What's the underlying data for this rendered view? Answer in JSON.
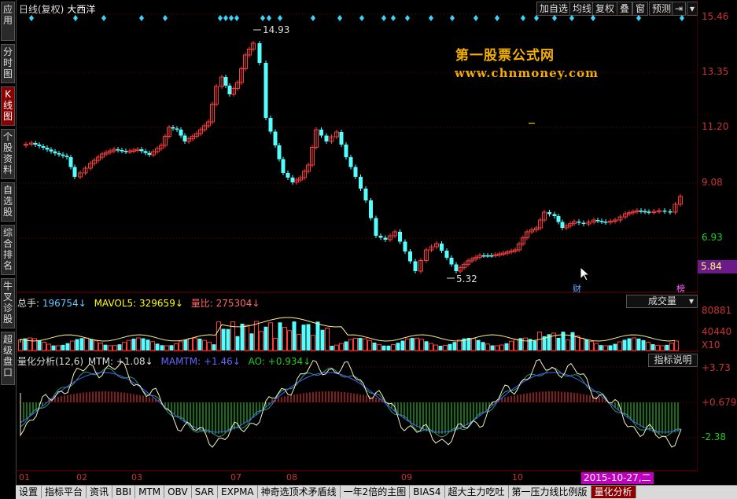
{
  "sidebar": {
    "tabs": [
      {
        "label": "应用",
        "active": false
      },
      {
        "label": "分时图",
        "active": false
      },
      {
        "label": "K线图",
        "active": true
      },
      {
        "label": "个股资料",
        "active": false
      },
      {
        "label": "自选股",
        "active": false
      },
      {
        "label": "综合排名",
        "active": false
      },
      {
        "label": "牛叉诊股",
        "active": false
      },
      {
        "label": "超级盘口",
        "active": false
      }
    ]
  },
  "header": {
    "period": "日线(复权)",
    "stock_name": "大西洋",
    "buttons": [
      "加自选",
      "均线",
      "复权",
      "叠",
      "窗",
      "预测"
    ]
  },
  "watermark": {
    "line1": "第一股票公式网",
    "line2": "www.chnmoney.com"
  },
  "main_chart": {
    "price_axis": [
      "15.46",
      "13.35",
      "11.20",
      "9.08",
      "6.93"
    ],
    "current_price": "5.84",
    "high_label": "14.93",
    "low_label": "5.32",
    "markers": {
      "cai": "财",
      "bang": "榜"
    }
  },
  "volume_panel": {
    "total_label": "总手:",
    "total_value": "196754",
    "mavol_label": "MAVOL5:",
    "mavol_value": "329659",
    "ratio_label": "量比:",
    "ratio_value": "275304",
    "selector": "成交量",
    "axis": [
      "80881",
      "40440",
      "X10"
    ]
  },
  "indicator_panel": {
    "name": "量化分析(12,6)",
    "mtm_label": "MTM:",
    "mtm_value": "+1.08",
    "mamtm_label": "MAMTM:",
    "mamtm_value": "+1.46",
    "ao_label": "AO:",
    "ao_value": "+0.934",
    "help_button": "指标说明",
    "axis": [
      "+3.73",
      "+0.679",
      "-2.38"
    ]
  },
  "x_axis": {
    "months": [
      "01",
      "02",
      "03",
      "07",
      "08",
      "09",
      "10"
    ],
    "cursor_date": "2015-10-27,二"
  },
  "bottom_tabs": [
    {
      "label": "设置",
      "active": false
    },
    {
      "label": "指标平台",
      "active": false
    },
    {
      "label": "资讯",
      "active": false
    },
    {
      "label": "BBI",
      "active": false
    },
    {
      "label": "MTM",
      "active": false
    },
    {
      "label": "OBV",
      "active": false
    },
    {
      "label": "SAR",
      "active": false
    },
    {
      "label": "EXPMA",
      "active": false
    },
    {
      "label": "神奇选顶术矛盾线",
      "active": false
    },
    {
      "label": "一年2倍的主图",
      "active": false
    },
    {
      "label": "BIAS4",
      "active": false
    },
    {
      "label": "超大主力吃吐",
      "active": false
    },
    {
      "label": "第一压力线比例版",
      "active": false
    },
    {
      "label": "量化分析",
      "active": true
    }
  ],
  "colors": {
    "up": "#ff3b3b",
    "down": "#54ffff",
    "accent": "#8a0000",
    "price_tag": "#6b1a8a",
    "date_tag": "#c000c0",
    "watermark": "#f5b000"
  }
}
